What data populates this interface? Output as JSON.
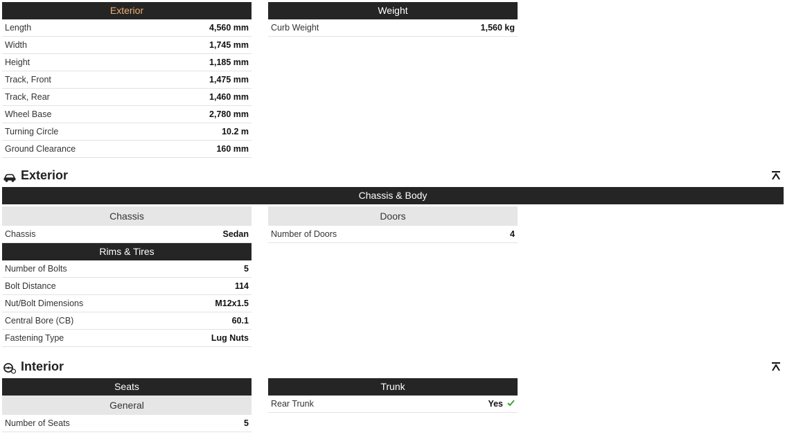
{
  "top": {
    "exterior_header": "Exterior",
    "exterior_rows": [
      {
        "label": "Length",
        "value": "4,560 mm"
      },
      {
        "label": "Width",
        "value": "1,745 mm"
      },
      {
        "label": "Height",
        "value": "1,185 mm"
      },
      {
        "label": "Track, Front",
        "value": "1,475 mm"
      },
      {
        "label": "Track, Rear",
        "value": "1,460 mm"
      },
      {
        "label": "Wheel Base",
        "value": "2,780 mm"
      },
      {
        "label": "Turning Circle",
        "value": "10.2 m"
      },
      {
        "label": "Ground Clearance",
        "value": "160 mm"
      }
    ],
    "weight_header": "Weight",
    "weight_rows": [
      {
        "label": "Curb Weight",
        "value": "1,560 kg"
      }
    ]
  },
  "exterior_section": {
    "title": "Exterior",
    "icon": "car-icon",
    "collapse_icon": "collapse-up-icon",
    "band_header": "Chassis & Body",
    "chassis_subheader": "Chassis",
    "chassis_rows": [
      {
        "label": "Chassis",
        "value": "Sedan"
      }
    ],
    "doors_subheader": "Doors",
    "doors_rows": [
      {
        "label": "Number of Doors",
        "value": "4"
      }
    ],
    "rims_header": "Rims & Tires",
    "rims_rows": [
      {
        "label": "Number of Bolts",
        "value": "5"
      },
      {
        "label": "Bolt Distance",
        "value": "114"
      },
      {
        "label": "Nut/Bolt Dimensions",
        "value": "M12x1.5"
      },
      {
        "label": "Central Bore (CB)",
        "value": "60.1"
      },
      {
        "label": "Fastening Type",
        "value": "Lug Nuts"
      }
    ]
  },
  "interior_section": {
    "title": "Interior",
    "icon": "steering-wheel-icon",
    "collapse_icon": "collapse-up-icon",
    "seats_header": "Seats",
    "general_subheader": "General",
    "seats_rows": [
      {
        "label": "Number of Seats",
        "value": "5"
      }
    ],
    "trunk_header": "Trunk",
    "trunk_rows": [
      {
        "label": "Rear Trunk",
        "value": "Yes"
      }
    ]
  },
  "colors": {
    "header_bg": "#252525",
    "accent": "#f0b070",
    "subheader_bg": "#e6e6e6",
    "check": "#3aa635"
  }
}
